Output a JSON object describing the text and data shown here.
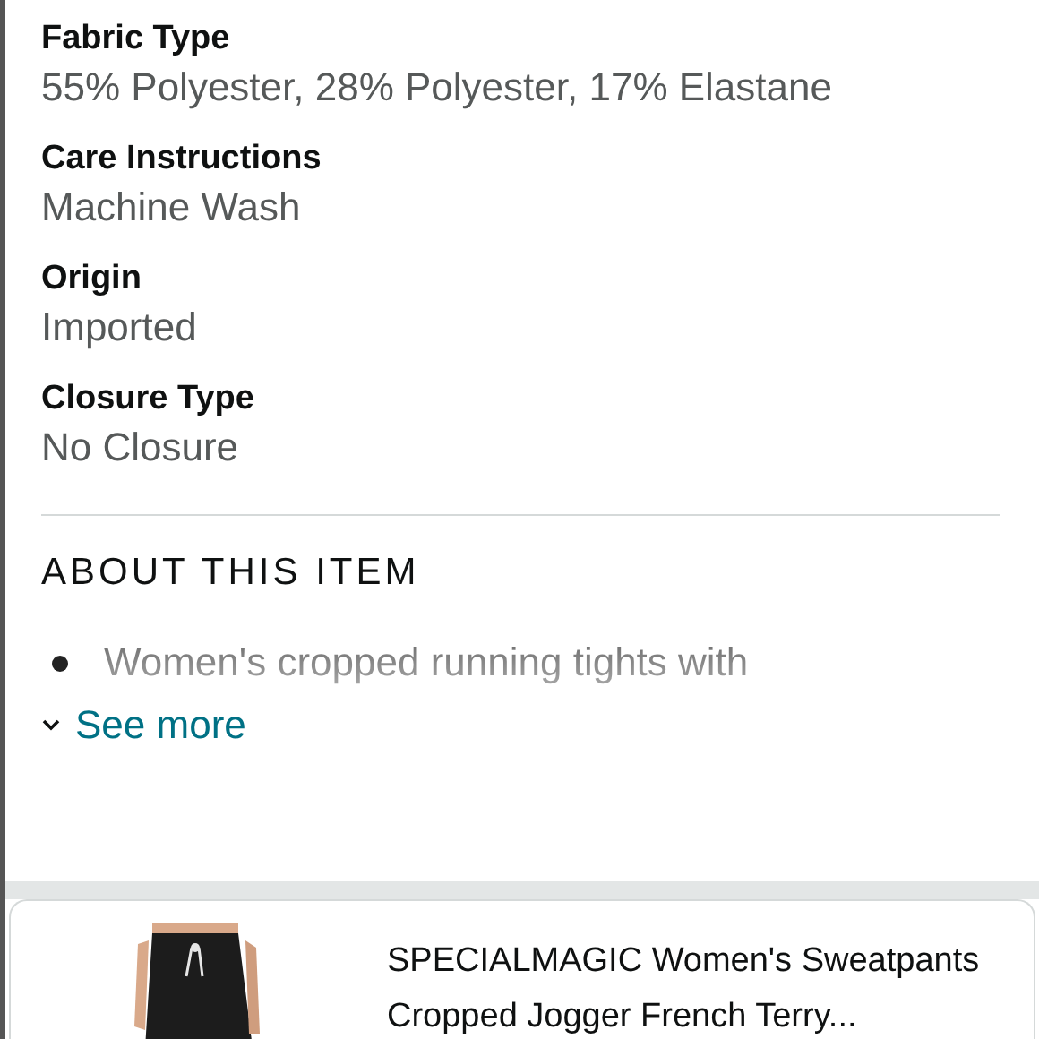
{
  "specs": [
    {
      "label": "Fabric Type",
      "value": "55% Polyester, 28% Polyester, 17% Elastane"
    },
    {
      "label": "Care Instructions",
      "value": "Machine Wash"
    },
    {
      "label": "Origin",
      "value": "Imported"
    },
    {
      "label": "Closure Type",
      "value": "No Closure"
    }
  ],
  "about": {
    "heading": "ABOUT THIS ITEM",
    "bullets": [
      "Women's cropped running tights with"
    ],
    "see_more": "See more"
  },
  "product_card": {
    "title": "SPECIALMAGIC Women's Sweatpants Cropped Jogger French Terry..."
  }
}
